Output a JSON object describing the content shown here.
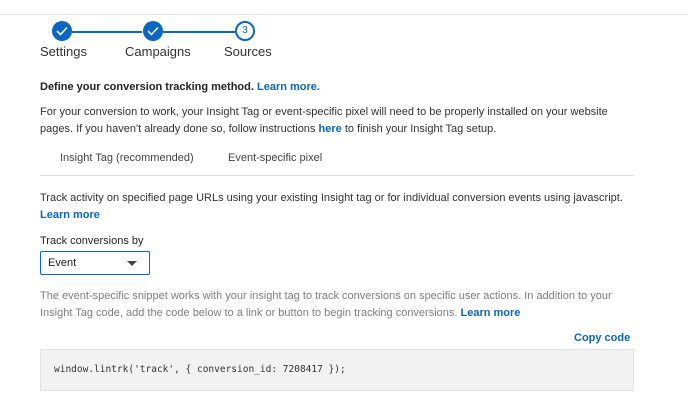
{
  "stepper": {
    "steps": [
      {
        "label": "Settings",
        "state": "done"
      },
      {
        "label": "Campaigns",
        "state": "done"
      },
      {
        "label": "Sources",
        "state": "current",
        "number": "3"
      }
    ]
  },
  "define": {
    "text": "Define your conversion tracking method.",
    "link": "Learn more."
  },
  "intro": {
    "line1": "For your conversion to work, your Insight Tag or event-specific pixel will need to be properly installed on your website",
    "line2_before": "pages. If you haven't already done so, follow instructions",
    "line2_link": "here",
    "line2_after": "to finish your Insight Tag setup."
  },
  "tabs": [
    {
      "label": "Insight Tag (recommended)"
    },
    {
      "label": "Event-specific pixel"
    }
  ],
  "track_activity": {
    "text": "Track activity on specified page URLs using your existing Insight tag or for individual conversion events using javascript.",
    "link": "Learn more"
  },
  "track_by": {
    "label": "Track conversions by",
    "value": "Event"
  },
  "snippet_desc": {
    "line1": "The event-specific snippet works with your insight tag to track conversions on specific user actions. In addition to your",
    "line2": "Insight Tag code, add the code below to a link or button to begin tracking conversions.",
    "link": "Learn more"
  },
  "copy_code": "Copy code",
  "code": "window.lintrk('track', { conversion_id: 7208417 });",
  "colors": {
    "accent": "#0a66c2"
  }
}
